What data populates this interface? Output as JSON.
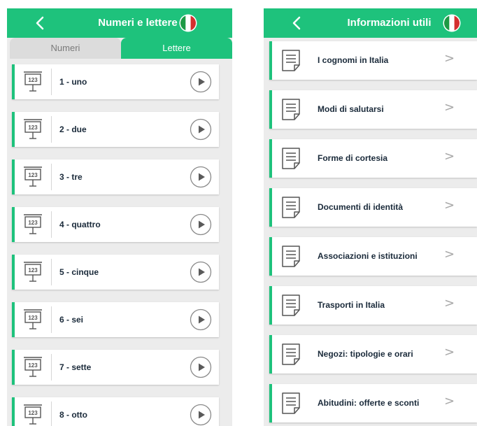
{
  "colors": {
    "accent": "#1ec27c",
    "card_text": "#1a2a3a",
    "background": "#ececec"
  },
  "numbers_screen": {
    "title": "Numeri e lettere",
    "back_icon": "chevron-left-icon",
    "flag_icon": "italy-flag-icon",
    "tabs": {
      "numbers": "Numeri",
      "letters": "Lettere",
      "active": "numbers"
    },
    "items": [
      {
        "label": "1 - uno"
      },
      {
        "label": "2 - due"
      },
      {
        "label": "3 - tre"
      },
      {
        "label": "4 - quattro"
      },
      {
        "label": "5 - cinque"
      },
      {
        "label": "6 - sei"
      },
      {
        "label": "7 - sette"
      },
      {
        "label": "8 - otto"
      }
    ],
    "item_icon": "numbers-board-icon",
    "action_icon": "play-icon",
    "board_text": "123"
  },
  "info_screen": {
    "title": "Informazioni utili",
    "back_icon": "chevron-left-icon",
    "flag_icon": "italy-flag-icon",
    "items": [
      {
        "label": "I cognomi in Italia"
      },
      {
        "label": "Modi di salutarsi"
      },
      {
        "label": "Forme di cortesia"
      },
      {
        "label": "Documenti di identità"
      },
      {
        "label": "Associazioni e istituzioni"
      },
      {
        "label": "Trasporti in Italia"
      },
      {
        "label": "Negozi: tipologie e orari"
      },
      {
        "label": "Abitudini: offerte e sconti"
      }
    ],
    "item_icon": "document-icon",
    "chevron": ">"
  }
}
